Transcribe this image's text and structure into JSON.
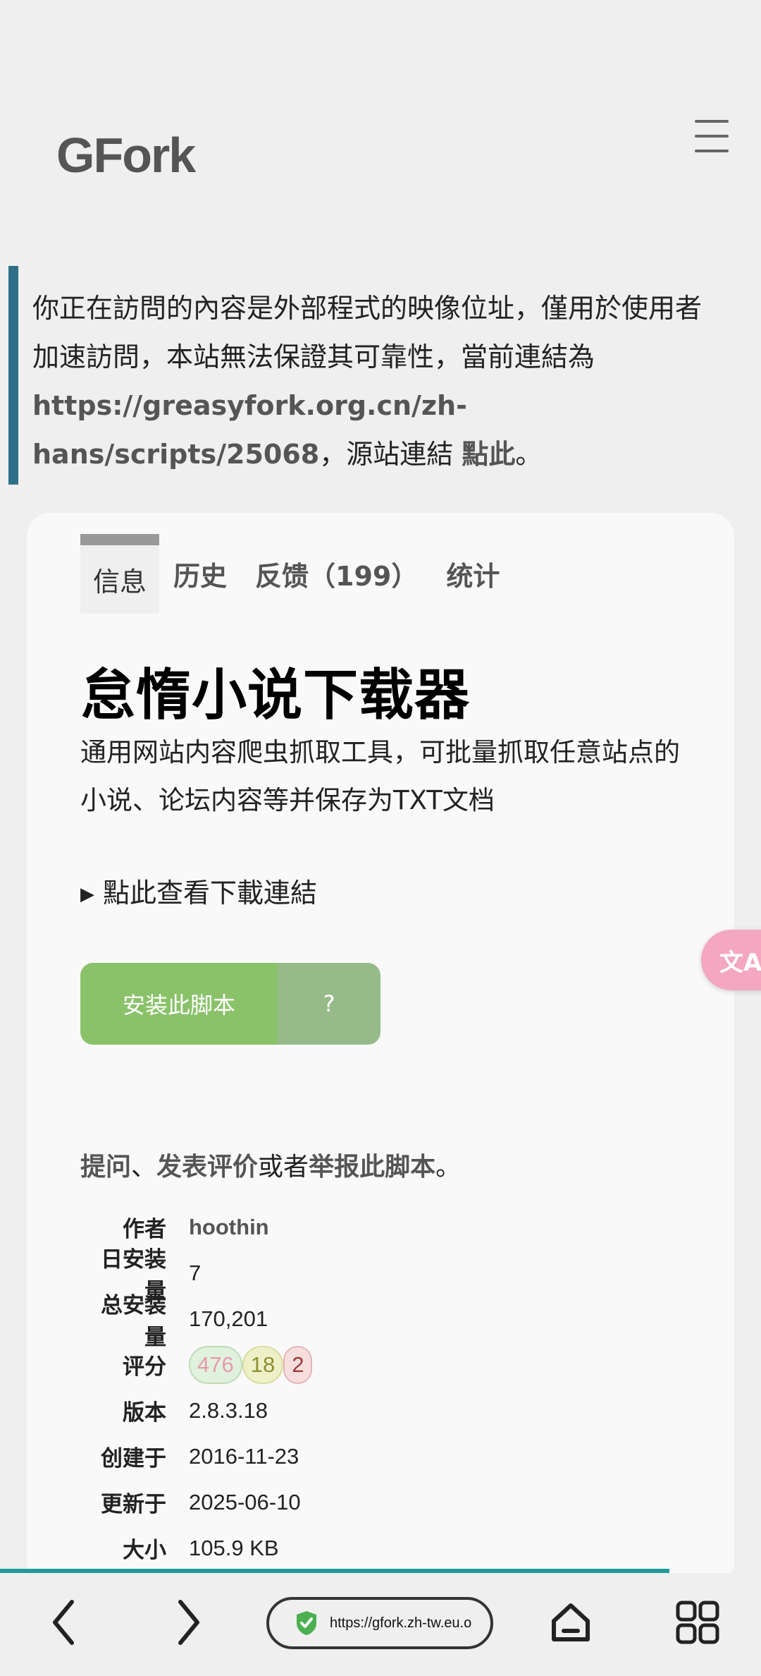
{
  "header": {
    "site_title": "GFork"
  },
  "notice": {
    "text_before": "你正在訪問的內容是外部程式的映像位址，僅用於使用者加速訪問，本站無法保證其可靠性，當前連結為 ",
    "link": "https://greasyfork.org.cn/zh-hans/scripts/25068",
    "text_middle": "，源站連結 ",
    "source_link": "點此",
    "text_end": "。"
  },
  "tabs": [
    {
      "label": "信息",
      "active": true
    },
    {
      "label": "历史",
      "active": false
    },
    {
      "label": "反馈（199）",
      "active": false
    },
    {
      "label": "统计",
      "active": false
    }
  ],
  "script": {
    "title": "怠惰小说下载器",
    "description": "通用网站内容爬虫抓取工具，可批量抓取任意站点的小说、论坛内容等并保存为TXT文档",
    "details_toggle": "點此查看下載連結",
    "install_label": "安装此脚本",
    "help_label": "?"
  },
  "feedback": {
    "link_ask": "提问",
    "sep1": "、",
    "link_review": "发表评价",
    "sep2": "或者",
    "link_report": "举报此脚本",
    "end": "。"
  },
  "info": {
    "author_label": "作者",
    "author": "hoothin",
    "daily_label": "日安装量",
    "daily": "7",
    "total_label": "总安装量",
    "total": "170,201",
    "rating_label": "评分",
    "rating_good": "476",
    "rating_ok": "18",
    "rating_bad": "2",
    "version_label": "版本",
    "version": "2.8.3.18",
    "created_label": "创建于",
    "created": "2016-11-23",
    "updated_label": "更新于",
    "updated": "2025-06-10",
    "size_label": "大小",
    "size": "105.9 KB"
  },
  "translate_fab": {
    "icon": "translate-icon",
    "label": "文A"
  },
  "browser": {
    "url": "https://gfork.zh-tw.eu.o",
    "page_load_progress": 0.88,
    "icons": [
      "back-arrow-icon",
      "forward-arrow-icon",
      "shield-check-icon",
      "home-icon",
      "apps-grid-icon"
    ]
  },
  "colors": {
    "accent": "#2f6f88",
    "install": "#8ac26a",
    "help": "#97bb88",
    "progress": "#1e9c96",
    "shield": "#4caf50"
  }
}
